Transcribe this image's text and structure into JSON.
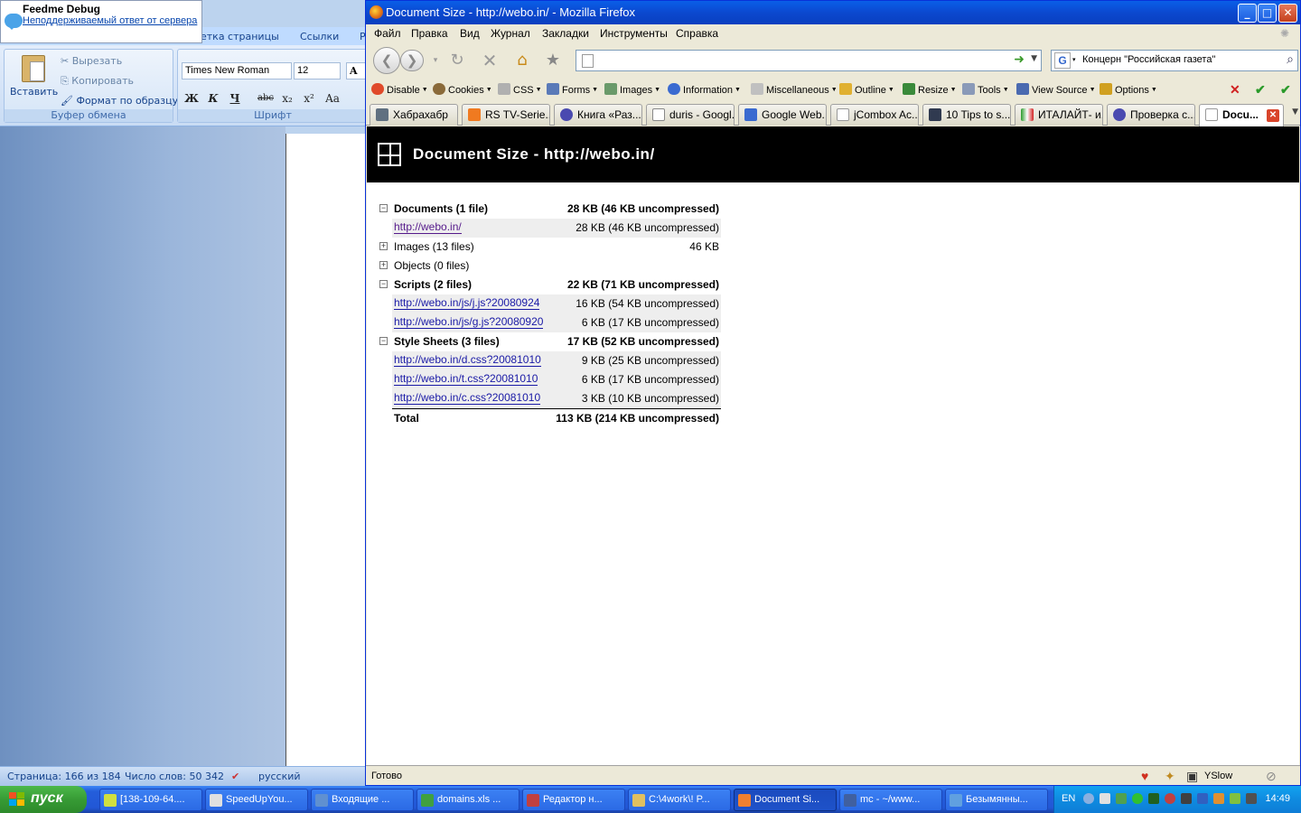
{
  "word": {
    "tabs": [
      "етка страницы",
      "Ссылки",
      "Р"
    ],
    "clipboard": {
      "paste": "Вставить",
      "cut": "Вырезать",
      "copy": "Копировать",
      "format_painter": "Формат по образцу",
      "group_title": "Буфер обмена"
    },
    "font": {
      "name": "Times New Roman",
      "size": "12",
      "grow": "A",
      "bold": "Ж",
      "italic": "К",
      "underline": "Ч",
      "strike": "abc",
      "subscript": "x₂",
      "superscript": "x²",
      "case": "Aa",
      "group_title": "Шрифт"
    },
    "status": {
      "page": "Страница: 166 из 184",
      "words": "Число слов: 50 342",
      "lang": "русский"
    }
  },
  "feedme": {
    "title": "Feedme Debug",
    "link": "Неподдерживаемый ответ от сервера"
  },
  "firefox": {
    "title": "Document Size - http://webo.in/ - Mozilla Firefox",
    "menu": [
      "Файл",
      "Правка",
      "Вид",
      "Журнал",
      "Закладки",
      "Инструменты",
      "Справка"
    ],
    "url": "",
    "search": "Концерн \"Российская газета\"",
    "webdev": [
      "Disable",
      "Cookies",
      "CSS",
      "Forms",
      "Images",
      "Information",
      "Miscellaneous",
      "Outline",
      "Resize",
      "Tools",
      "View Source",
      "Options"
    ],
    "tabs": [
      "Хабрахабр",
      "RS TV-Serie...",
      "Книга «Раз...",
      "duris - Googl...",
      "Google Web...",
      "jCombox Ac...",
      "10 Tips to s...",
      "ИТАЛАЙТ- и...",
      "Проверка с...",
      "Docu..."
    ],
    "status": "Готово",
    "yslow": "YSlow"
  },
  "report": {
    "title": "Document Size - http://webo.in/",
    "groups": [
      {
        "label": "Documents (1 file)",
        "value": "28 KB (46 KB uncompressed)",
        "expanded": true,
        "files": [
          {
            "url": "http://webo.in/",
            "value": "28 KB (46 KB uncompressed)",
            "visited": true
          }
        ]
      },
      {
        "label": "Images (13 files)",
        "value": "46 KB",
        "expanded": false,
        "files": []
      },
      {
        "label": "Objects (0 files)",
        "value": "",
        "expanded": false,
        "files": []
      },
      {
        "label": "Scripts (2 files)",
        "value": "22 KB (71 KB uncompressed)",
        "expanded": true,
        "files": [
          {
            "url": "http://webo.in/js/j.js?20080924",
            "value": "16 KB (54 KB uncompressed)"
          },
          {
            "url": "http://webo.in/js/g.js?20080920",
            "value": "6 KB (17 KB uncompressed)"
          }
        ]
      },
      {
        "label": "Style Sheets (3 files)",
        "value": "17 KB (52 KB uncompressed)",
        "expanded": true,
        "files": [
          {
            "url": "http://webo.in/d.css?20081010",
            "value": "9 KB (25 KB uncompressed)"
          },
          {
            "url": "http://webo.in/t.css?20081010",
            "value": "6 KB (17 KB uncompressed)"
          },
          {
            "url": "http://webo.in/c.css?20081010",
            "value": "3 KB (10 KB uncompressed)"
          }
        ]
      }
    ],
    "total_label": "Total",
    "total_value": "113 KB (214 KB uncompressed)"
  },
  "taskbar": {
    "start": "пуск",
    "tasks": [
      "[138-109-64....",
      "SpeedUpYou...",
      "Входящие ...",
      "domains.xls ...",
      "Редактор н...",
      "C:\\4work\\! P...",
      "Document Si...",
      "mc - ~/www...",
      "Безымянны..."
    ],
    "active_index": 6,
    "lang": "EN",
    "clock": "14:49"
  }
}
